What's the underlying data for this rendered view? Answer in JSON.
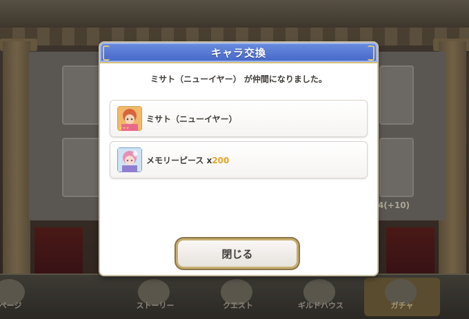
{
  "dialog": {
    "title": "キャラ交換",
    "message": "ミサト（ニューイヤー） が仲間になりました。",
    "close_label": "閉じる"
  },
  "rewards": [
    {
      "name": "ミサト（ニューイヤー）",
      "icon": "character-portrait-icon"
    },
    {
      "name": "メモリーピース x",
      "count": "200",
      "icon": "memory-piece-icon"
    }
  ],
  "background": {
    "counter_text": "4(+10)"
  },
  "bottom_nav": {
    "items": [
      {
        "label": "ページ"
      },
      {
        "label": "ストーリー"
      },
      {
        "label": "クエスト"
      },
      {
        "label": "ギルドハウス"
      },
      {
        "label": "ガチャ"
      }
    ]
  },
  "colors": {
    "header_blue": "#4567c8",
    "count_gold": "#e0a52a",
    "frame_gold": "#c7ae6f"
  }
}
